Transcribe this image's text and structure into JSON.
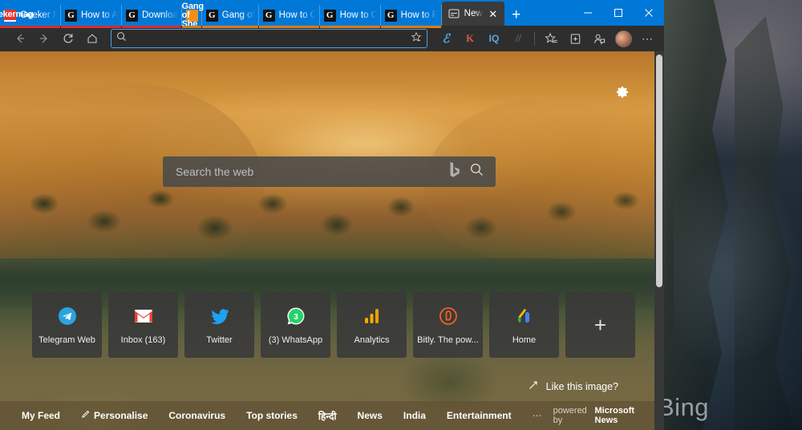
{
  "window": {
    "controls": {
      "minimize": "─",
      "maximize": "☐",
      "close": "✕"
    }
  },
  "tabs": [
    {
      "label": "Geeker M",
      "favicon": "geekermag-favicon",
      "favicon_text": "Geekermag",
      "group": "red",
      "active": false
    },
    {
      "label": "How to A",
      "favicon": "g-favicon",
      "favicon_text": "G",
      "group": "red",
      "active": false
    },
    {
      "label": "Downloa",
      "favicon": "g-favicon",
      "favicon_text": "G",
      "group": "red",
      "active": false
    },
    {
      "label": "Gang of",
      "favicon": "gangofshe-favicon",
      "favicon_text": "Gang of She",
      "group": "orange",
      "active": false
    },
    {
      "label": "How to C",
      "favicon": "g-favicon",
      "favicon_text": "G",
      "group": "orange",
      "active": false
    },
    {
      "label": "How to C",
      "favicon": "g-favicon",
      "favicon_text": "G",
      "group": "orange",
      "active": false
    },
    {
      "label": "How to F",
      "favicon": "g-favicon",
      "favicon_text": "G",
      "group": "orange",
      "active": false
    },
    {
      "label": "New",
      "favicon": "newtab-favicon",
      "favicon_text": "",
      "group": "none",
      "active": true
    }
  ],
  "tabstrip": {
    "new_tab_label": "+",
    "close_label": "✕"
  },
  "toolbar": {
    "back_icon": "←",
    "forward_icon": "→",
    "refresh_icon": "↻",
    "home_icon": "⌂",
    "address_value": "",
    "address_placeholder": "",
    "search_icon": "⌕",
    "favorite_icon": "☆",
    "extensions": [
      {
        "name": "extension-editor",
        "glyph": "ℰ"
      },
      {
        "name": "extension-k",
        "glyph": "K"
      },
      {
        "name": "extension-iq",
        "glyph": "IQ"
      },
      {
        "name": "extension-dim",
        "glyph": "//"
      }
    ],
    "favorites_icon": "☆",
    "collections_icon": "⧉",
    "share_icon": "⚲",
    "avatar_name": "profile-avatar",
    "settings_icon": "⋯"
  },
  "newtab": {
    "gear_icon": "⚙",
    "search": {
      "placeholder": "Search the web",
      "value": "",
      "bing_logo": "b",
      "search_icon": "⌕"
    },
    "tiles": [
      {
        "label": "Telegram Web",
        "icon": "telegram-icon"
      },
      {
        "label": "Inbox (163)",
        "icon": "gmail-icon"
      },
      {
        "label": "Twitter",
        "icon": "twitter-icon"
      },
      {
        "label": "(3) WhatsApp",
        "icon": "whatsapp-icon"
      },
      {
        "label": "Analytics",
        "icon": "google-analytics-icon"
      },
      {
        "label": "Bitly. The pow...",
        "icon": "bitly-icon"
      },
      {
        "label": "Home",
        "icon": "google-home-icon"
      }
    ],
    "add_tile_label": "+",
    "like_image": {
      "text": "Like this image?",
      "icon": "↗"
    },
    "feed": {
      "items": [
        {
          "label": "My Feed",
          "icon": ""
        },
        {
          "label": "Personalise",
          "icon": "✎"
        },
        {
          "label": "Coronavirus",
          "icon": ""
        },
        {
          "label": "Top stories",
          "icon": ""
        },
        {
          "label": "हिन्दी",
          "icon": ""
        },
        {
          "label": "News",
          "icon": ""
        },
        {
          "label": "India",
          "icon": ""
        },
        {
          "label": "Entertainment",
          "icon": ""
        },
        {
          "label": "⋯",
          "icon": ""
        }
      ],
      "powered_prefix": "powered by",
      "powered_brand": "Microsoft News"
    }
  },
  "desktop": {
    "watermark": "Bing"
  },
  "colors": {
    "titlebar": "#0078d7",
    "toolbar": "#2e2e2e",
    "address_border": "#4ba2e8",
    "tab_group_red": "#d32f2f",
    "tab_group_orange": "#e07b10",
    "tile_bg": "#3a3a3a"
  }
}
